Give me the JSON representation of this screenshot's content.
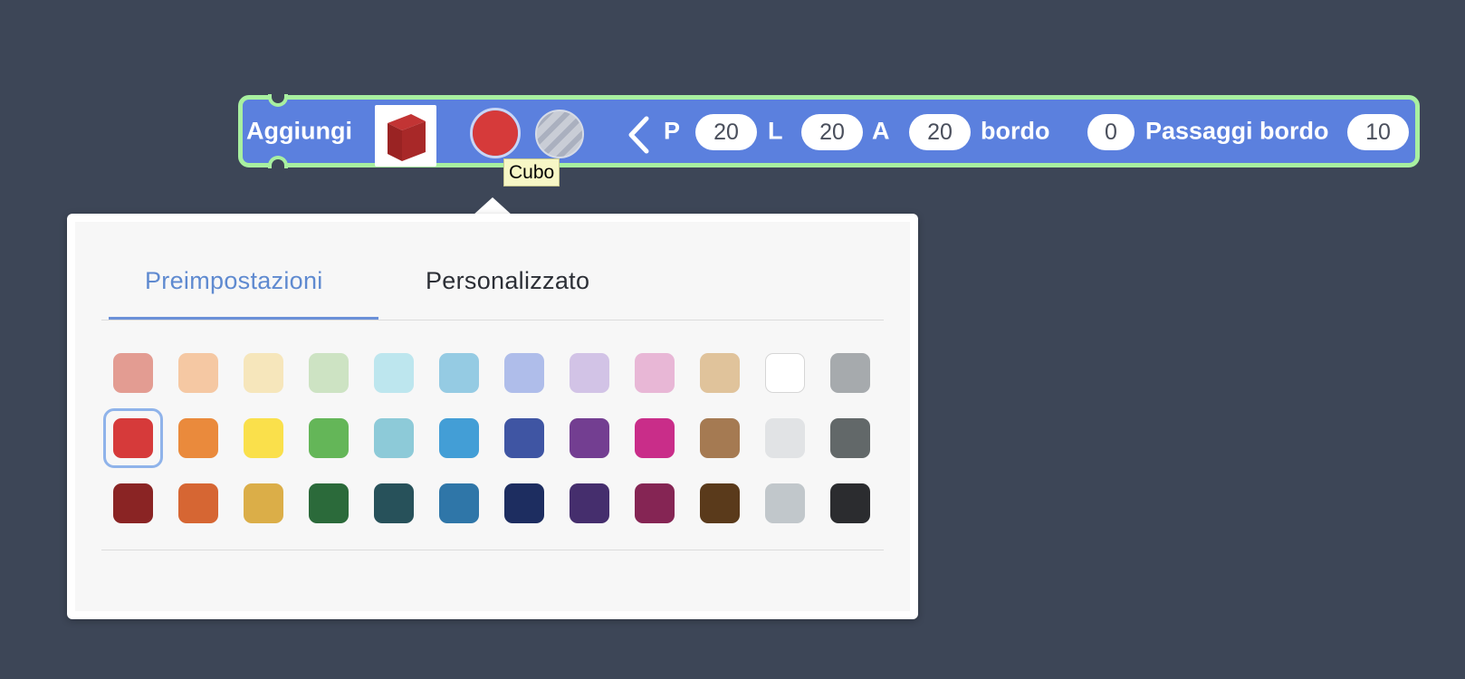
{
  "block": {
    "label": "Aggiungi",
    "shape_name": "Cubo",
    "color": "#d63a3a",
    "accent": "#5b80de",
    "outline": "#a8f0a0",
    "fields": {
      "p_label": "P",
      "p_value": "20",
      "l_label": "L",
      "l_value": "20",
      "a_label": "A",
      "a_value": "20",
      "bordo_label": "bordo",
      "bordo_value": "0",
      "passaggi_label": "Passaggi bordo",
      "passaggi_value": "10"
    },
    "icons": [
      "cube-icon",
      "color-swatch-icon",
      "material-icon",
      "chevron-left-icon"
    ]
  },
  "tooltip": {
    "text": "Cubo"
  },
  "color_picker": {
    "tabs": [
      {
        "label": "Preimpostazioni",
        "active": true
      },
      {
        "label": "Personalizzato",
        "active": false
      }
    ],
    "selected": "#d63a3a",
    "swatches": [
      [
        "#e39c92",
        "#f5c8a3",
        "#f6e6bb",
        "#cde3c3",
        "#bde6ee",
        "#95cbe3",
        "#afbdea",
        "#d2c3e6",
        "#e8b7d6",
        "#e0c39b",
        "#ffffff",
        "#a6aaad"
      ],
      [
        "#d63a3a",
        "#ea8a3c",
        "#fae04b",
        "#64b658",
        "#8dcad8",
        "#439ed6",
        "#3f55a3",
        "#733e91",
        "#c92d89",
        "#a57a52",
        "#e1e3e5",
        "#626869"
      ],
      [
        "#8a2424",
        "#d66633",
        "#dbae48",
        "#2b6a3a",
        "#27515a",
        "#2f76a8",
        "#1d2d60",
        "#452e6d",
        "#852554",
        "#5a3a1b",
        "#c1c7cb",
        "#2b2c2f"
      ]
    ]
  }
}
